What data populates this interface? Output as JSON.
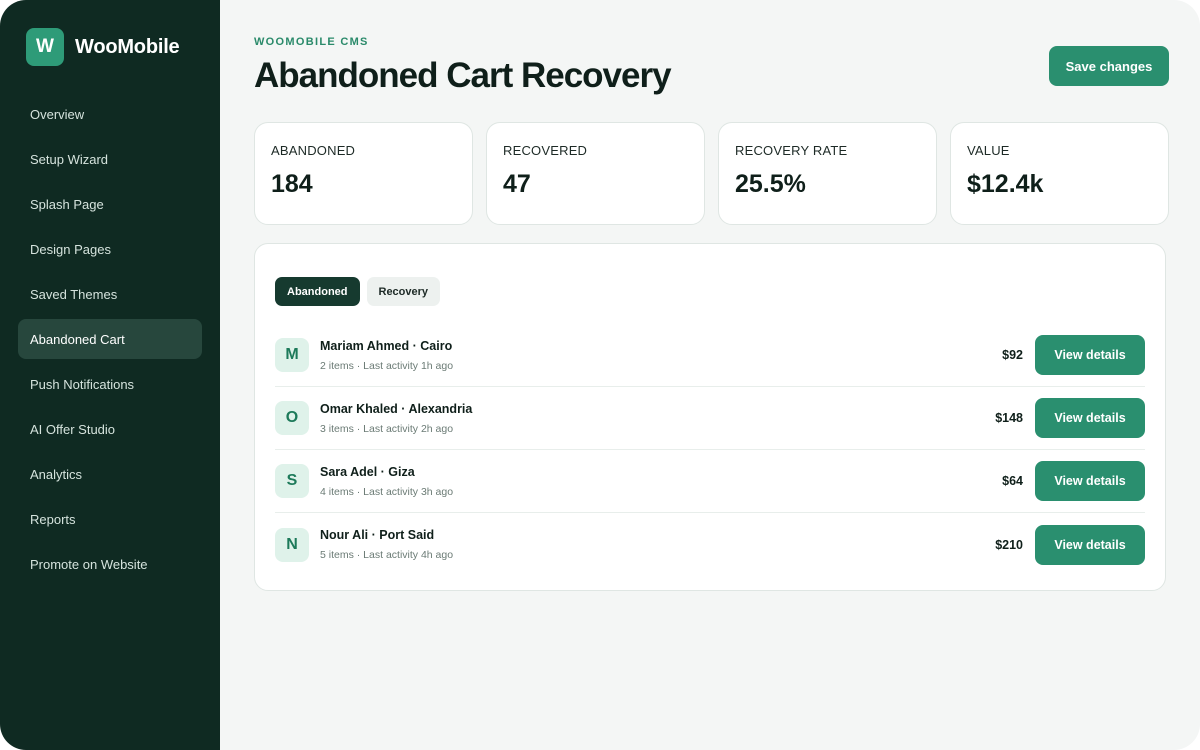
{
  "brand": {
    "logo_letter": "W",
    "name": "WooMobile"
  },
  "sidebar": {
    "items": [
      {
        "label": "Overview"
      },
      {
        "label": "Setup Wizard"
      },
      {
        "label": "Splash Page"
      },
      {
        "label": "Design Pages"
      },
      {
        "label": "Saved Themes"
      },
      {
        "label": "Abandoned Cart",
        "active": true
      },
      {
        "label": "Push Notifications"
      },
      {
        "label": "AI Offer Studio"
      },
      {
        "label": "Analytics"
      },
      {
        "label": "Reports"
      },
      {
        "label": "Promote on Website"
      }
    ]
  },
  "header": {
    "eyebrow": "WOOMOBILE CMS",
    "title": "Abandoned Cart Recovery",
    "save_label": "Save changes"
  },
  "stats": [
    {
      "label": "ABANDONED",
      "value": "184"
    },
    {
      "label": "RECOVERED",
      "value": "47"
    },
    {
      "label": "RECOVERY RATE",
      "value": "25.5%"
    },
    {
      "label": "VALUE",
      "value": "$12.4k"
    }
  ],
  "tabs": [
    {
      "label": "Abandoned",
      "active": true
    },
    {
      "label": "Recovery",
      "active": false
    }
  ],
  "carts": [
    {
      "initial": "M",
      "name": "Mariam Ahmed · Cairo",
      "meta": "2 items · Last activity 1h ago",
      "amount": "$92",
      "action": "View details"
    },
    {
      "initial": "O",
      "name": "Omar Khaled · Alexandria",
      "meta": "3 items · Last activity 2h ago",
      "amount": "$148",
      "action": "View details"
    },
    {
      "initial": "S",
      "name": "Sara Adel · Giza",
      "meta": "4 items · Last activity 3h ago",
      "amount": "$64",
      "action": "View details"
    },
    {
      "initial": "N",
      "name": "Nour Ali · Port Said",
      "meta": "5 items · Last activity 4h ago",
      "amount": "$210",
      "action": "View details"
    }
  ],
  "colors": {
    "sidebar_bg": "#0f2a22",
    "accent": "#2a8f6f",
    "active_nav": "#27473d",
    "avatar_bg": "#dff2ea",
    "avatar_text": "#1d7a5a"
  }
}
